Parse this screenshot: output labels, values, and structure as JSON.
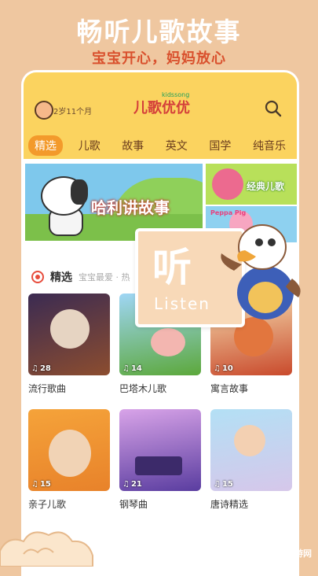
{
  "promo": {
    "title": "畅听儿歌故事",
    "subtitle": "宝宝开心，妈妈放心"
  },
  "header": {
    "age": "2岁11个月",
    "logo": "儿歌优优",
    "logo_accent": "kidssong"
  },
  "tabs": [
    "精选",
    "儿歌",
    "故事",
    "英文",
    "国学",
    "纯音乐"
  ],
  "banners": {
    "main": "哈利讲故事",
    "side_top": "经典儿歌",
    "side_bottom": "Peppa Pig"
  },
  "section": {
    "title": "精选",
    "subtitle": "宝宝最爱 · 热"
  },
  "cards": [
    {
      "count": "28",
      "title": "流行歌曲"
    },
    {
      "count": "14",
      "title": "巴塔木儿歌"
    },
    {
      "count": "10",
      "title": "寓言故事"
    },
    {
      "count": "15",
      "title": "亲子儿歌"
    },
    {
      "count": "21",
      "title": "钢琴曲"
    },
    {
      "count": "15",
      "title": "唐诗精选"
    }
  ],
  "listen": {
    "cn": "听",
    "en": "Listen"
  },
  "watermark": {
    "brand": "2265",
    "suffix": "手游网"
  },
  "colors": {
    "accent": "#f39a2b",
    "header": "#fbd35f",
    "promo_bg": "#efc7a0",
    "promo_sub": "#d9512e"
  }
}
